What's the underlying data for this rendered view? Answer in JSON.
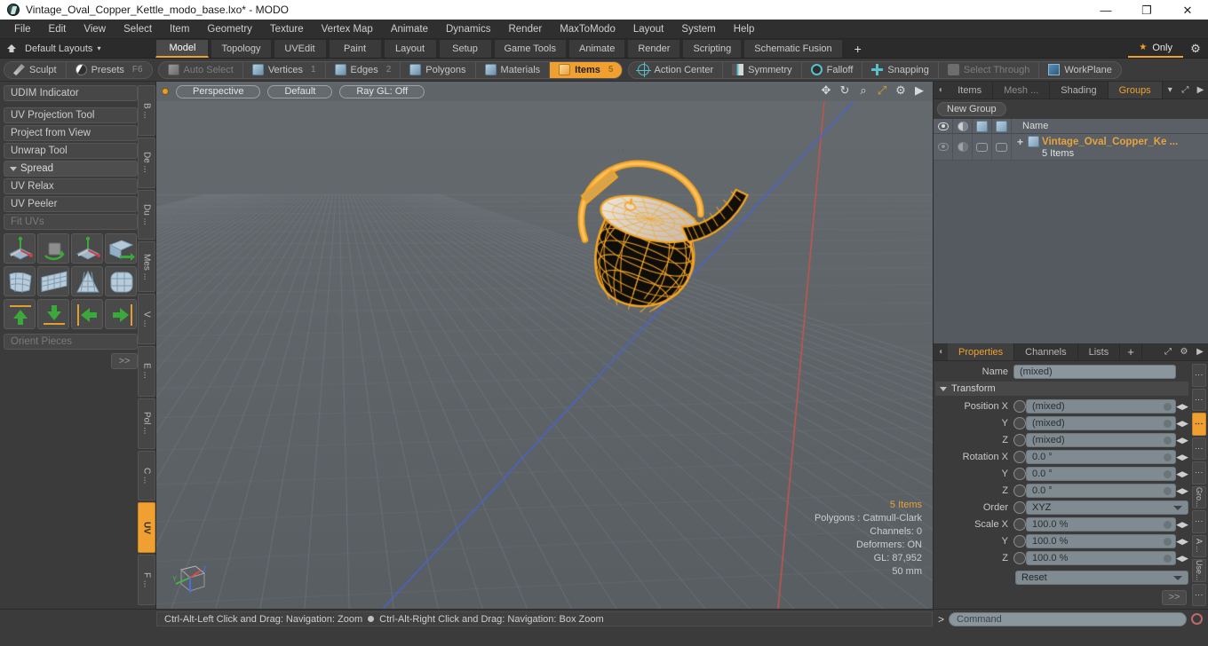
{
  "window": {
    "title": "Vintage_Oval_Copper_Kettle_modo_base.lxo* - MODO",
    "logo_name": "modo-logo",
    "minimize": "—",
    "maximize": "❐",
    "close": "✕"
  },
  "menubar": {
    "items": [
      "File",
      "Edit",
      "View",
      "Select",
      "Item",
      "Geometry",
      "Texture",
      "Vertex Map",
      "Animate",
      "Dynamics",
      "Render",
      "MaxToModo",
      "Layout",
      "System",
      "Help"
    ]
  },
  "layoutbar": {
    "home_icon": "home-icon",
    "layouts_label": "Default Layouts",
    "caret": "▾",
    "tabs": [
      {
        "label": "Model",
        "active": true
      },
      {
        "label": "Topology",
        "active": false
      },
      {
        "label": "UVEdit",
        "active": false
      },
      {
        "label": "Paint",
        "active": false
      },
      {
        "label": "Layout",
        "active": false
      },
      {
        "label": "Setup",
        "active": false
      },
      {
        "label": "Game Tools",
        "active": false
      },
      {
        "label": "Animate",
        "active": false
      },
      {
        "label": "Render",
        "active": false
      },
      {
        "label": "Scripting",
        "active": false
      },
      {
        "label": "Schematic Fusion",
        "active": false
      }
    ],
    "add_tab": "+",
    "only_star": "★",
    "only_label": "Only",
    "gear": "⚙"
  },
  "modebar": {
    "group1": [
      {
        "label": "Sculpt",
        "icon": "pencil-icon",
        "state": "normal",
        "shortcut": ""
      },
      {
        "label": "Presets",
        "icon": "sphere-icon",
        "state": "normal",
        "shortcut": "F6"
      }
    ],
    "group2": [
      {
        "label": "Auto Select",
        "icon": "cube-gray-icon",
        "state": "dim",
        "count": ""
      },
      {
        "label": "Vertices",
        "icon": "cube-blue-icon",
        "state": "normal",
        "count": "1"
      },
      {
        "label": "Edges",
        "icon": "cube-blue-icon",
        "state": "normal",
        "count": "2"
      },
      {
        "label": "Polygons",
        "icon": "cube-blue-icon",
        "state": "normal",
        "count": ""
      },
      {
        "label": "Materials",
        "icon": "cube-blue-icon",
        "state": "normal",
        "count": ""
      },
      {
        "label": "Items",
        "icon": "cube-orange-icon",
        "state": "selected",
        "count": "5"
      }
    ],
    "group3": [
      {
        "label": "Action Center",
        "icon": "action-center-icon",
        "state": "normal"
      },
      {
        "label": "Symmetry",
        "icon": "symmetry-icon",
        "state": "normal"
      },
      {
        "label": "Falloff",
        "icon": "falloff-icon",
        "state": "normal"
      },
      {
        "label": "Snapping",
        "icon": "snapping-icon",
        "state": "normal"
      },
      {
        "label": "Select Through",
        "icon": "select-through-icon",
        "state": "dim"
      },
      {
        "label": "WorkPlane",
        "icon": "workplane-icon",
        "state": "normal"
      }
    ]
  },
  "leftpanel": {
    "buttons": [
      {
        "label": "UDIM Indicator",
        "kind": "button",
        "gap_after": true
      },
      {
        "label": "UV Projection Tool",
        "kind": "button"
      },
      {
        "label": "Project from View",
        "kind": "button"
      },
      {
        "label": "Unwrap Tool",
        "kind": "button"
      },
      {
        "label": "Spread",
        "kind": "group"
      },
      {
        "label": "UV Relax",
        "kind": "button"
      },
      {
        "label": "UV Peeler",
        "kind": "button"
      },
      {
        "label": "Fit UVs",
        "kind": "disabled"
      }
    ],
    "icon_rows": [
      [
        "uv-move-gizmo-icon",
        "uv-rotate-icon",
        "uv-scale-gizmo-icon",
        "uv-flip-icon"
      ],
      [
        "uv-fit-icon",
        "uv-grid-icon",
        "uv-cone-icon",
        "uv-sphere-grid-icon"
      ],
      [
        "uv-align-up-icon",
        "uv-align-down-icon",
        "uv-align-left-icon",
        "uv-align-right-icon"
      ]
    ],
    "orient_field": "Orient Pieces",
    "more_button": ">>",
    "vtabs": [
      {
        "label": "B ...",
        "active": false
      },
      {
        "label": "De ...",
        "active": false
      },
      {
        "label": "Du ...",
        "active": false
      },
      {
        "label": "Mes ...",
        "active": false
      },
      {
        "label": "V ...",
        "active": false
      },
      {
        "label": "E ...",
        "active": false
      },
      {
        "label": "Pol ...",
        "active": false
      },
      {
        "label": "C ...",
        "active": false
      },
      {
        "label": "UV",
        "active": true
      },
      {
        "label": "F ...",
        "active": false
      }
    ]
  },
  "viewport": {
    "indicator": "viewport-active-dot",
    "pills": [
      "Perspective",
      "Default",
      "Ray GL: Off"
    ],
    "tools": [
      {
        "icon": "move-view-icon",
        "glyph": "✥"
      },
      {
        "icon": "rotate-view-icon",
        "glyph": "↻"
      },
      {
        "icon": "zoom-view-icon",
        "glyph": "⌕"
      },
      {
        "icon": "fit-view-icon",
        "glyph": "⤢"
      },
      {
        "icon": "viewport-settings-gear-icon",
        "glyph": "⚙"
      },
      {
        "icon": "viewport-menu-arrow-icon",
        "glyph": "▶"
      }
    ],
    "stats": {
      "items": "5 Items",
      "polygons": "Polygons : Catmull-Clark",
      "channels": "Channels: 0",
      "deformers": "Deformers: ON",
      "gl": "GL: 87,952",
      "scale": "50 mm"
    },
    "gizmo_axes": [
      "X",
      "Y",
      "Z"
    ],
    "model_name": "vintage-oval-copper-kettle-wireframe"
  },
  "rightpanel": {
    "top_tabs": [
      {
        "label": "Items",
        "active": false
      },
      {
        "label": "Mesh ...",
        "active": false,
        "dim": true
      },
      {
        "label": "Shading",
        "active": false
      },
      {
        "label": "Groups",
        "active": true
      }
    ],
    "top_tab_caret": "▾",
    "top_expand_icon": "expand-panel-icon",
    "top_menu_icon": "panel-menu-arrow-icon",
    "new_group_button": "New Group",
    "tree_columns": [
      "eye-icon",
      "shade-icon",
      "cube-outline-icon",
      "cube-solid-icon"
    ],
    "tree_name_header": "Name",
    "tree_rows": [
      {
        "name": "Vintage_Oval_Copper_Ke ...",
        "sub": "5 Items",
        "expander": "+",
        "item_icon": "group-cube-icon"
      }
    ],
    "prop_tabs": [
      {
        "label": "Properties",
        "active": true
      },
      {
        "label": "Channels",
        "active": false
      },
      {
        "label": "Lists",
        "active": false
      },
      {
        "label": "+",
        "active": false
      }
    ],
    "prop_expand_icon": "expand-panel-icon",
    "prop_gear_icon": "panel-gear-icon",
    "prop_menu_icon": "panel-menu-arrow-icon",
    "properties": {
      "name_label": "Name",
      "name_value": "(mixed)",
      "transform_section": "Transform",
      "rows": [
        {
          "label": "Position X",
          "value": "(mixed)",
          "type": "field"
        },
        {
          "label": "Y",
          "value": "(mixed)",
          "type": "field"
        },
        {
          "label": "Z",
          "value": "(mixed)",
          "type": "field"
        },
        {
          "label": "Rotation X",
          "value": "0.0 °",
          "type": "field"
        },
        {
          "label": "Y",
          "value": "0.0 °",
          "type": "field"
        },
        {
          "label": "Z",
          "value": "0.0 °",
          "type": "field"
        },
        {
          "label": "Order",
          "value": "XYZ",
          "type": "select"
        },
        {
          "label": "Scale X",
          "value": "100.0 %",
          "type": "field"
        },
        {
          "label": "Y",
          "value": "100.0 %",
          "type": "field"
        },
        {
          "label": "Z",
          "value": "100.0 %",
          "type": "field"
        }
      ],
      "reset_value": "Reset",
      "more_button": ">>"
    },
    "vtabs": [
      {
        "label": "⋮",
        "active": false
      },
      {
        "label": "⋮",
        "active": false
      },
      {
        "label": "⋮",
        "active": true
      },
      {
        "label": "⋮",
        "active": false
      },
      {
        "label": "⋮",
        "active": false
      },
      {
        "label": "Gro...",
        "active": false
      },
      {
        "label": "⋮",
        "active": false
      },
      {
        "label": "A ...",
        "active": false
      },
      {
        "label": "Use...",
        "active": false
      },
      {
        "label": "⋮",
        "active": false
      }
    ]
  },
  "statusbar": {
    "hint_left": "Ctrl-Alt-Left Click and Drag: Navigation: Zoom",
    "hint_right": "Ctrl-Alt-Right Click and Drag: Navigation: Box Zoom",
    "prompt": ">",
    "command_placeholder": "Command",
    "record_icon": "record-macro-icon"
  },
  "colors": {
    "accent": "#f0a030",
    "panel_bg": "#3b3b3b",
    "viewport_bg": "#5e6468",
    "field_bg": "#7f8a91",
    "teal": "#58c0c8"
  }
}
